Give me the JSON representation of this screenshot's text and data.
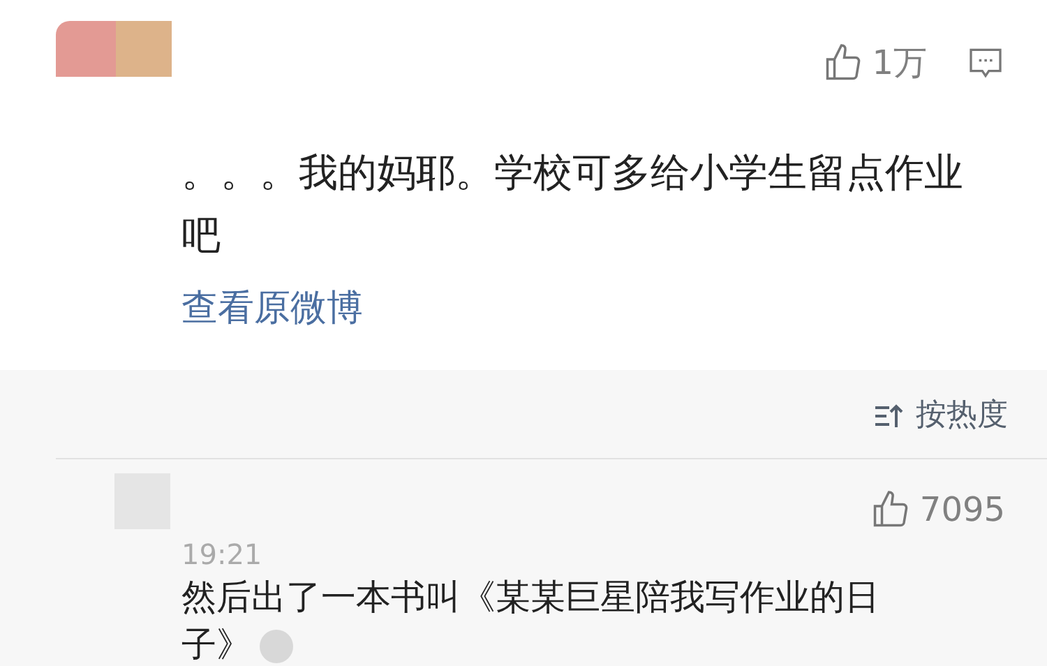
{
  "comments": [
    {
      "likes": "1万",
      "text": "。。。我的妈耶。学校可多给小学生留点作业吧",
      "link": "查看原微博",
      "reply_button": true,
      "kind": "photo"
    },
    {
      "likes": "7095",
      "time": "19:21",
      "text": "然后出了一本书叫《某某巨星陪我写作业的日子》",
      "reply_button": false,
      "kind": "plain"
    }
  ],
  "sort": {
    "label": "按热度"
  }
}
